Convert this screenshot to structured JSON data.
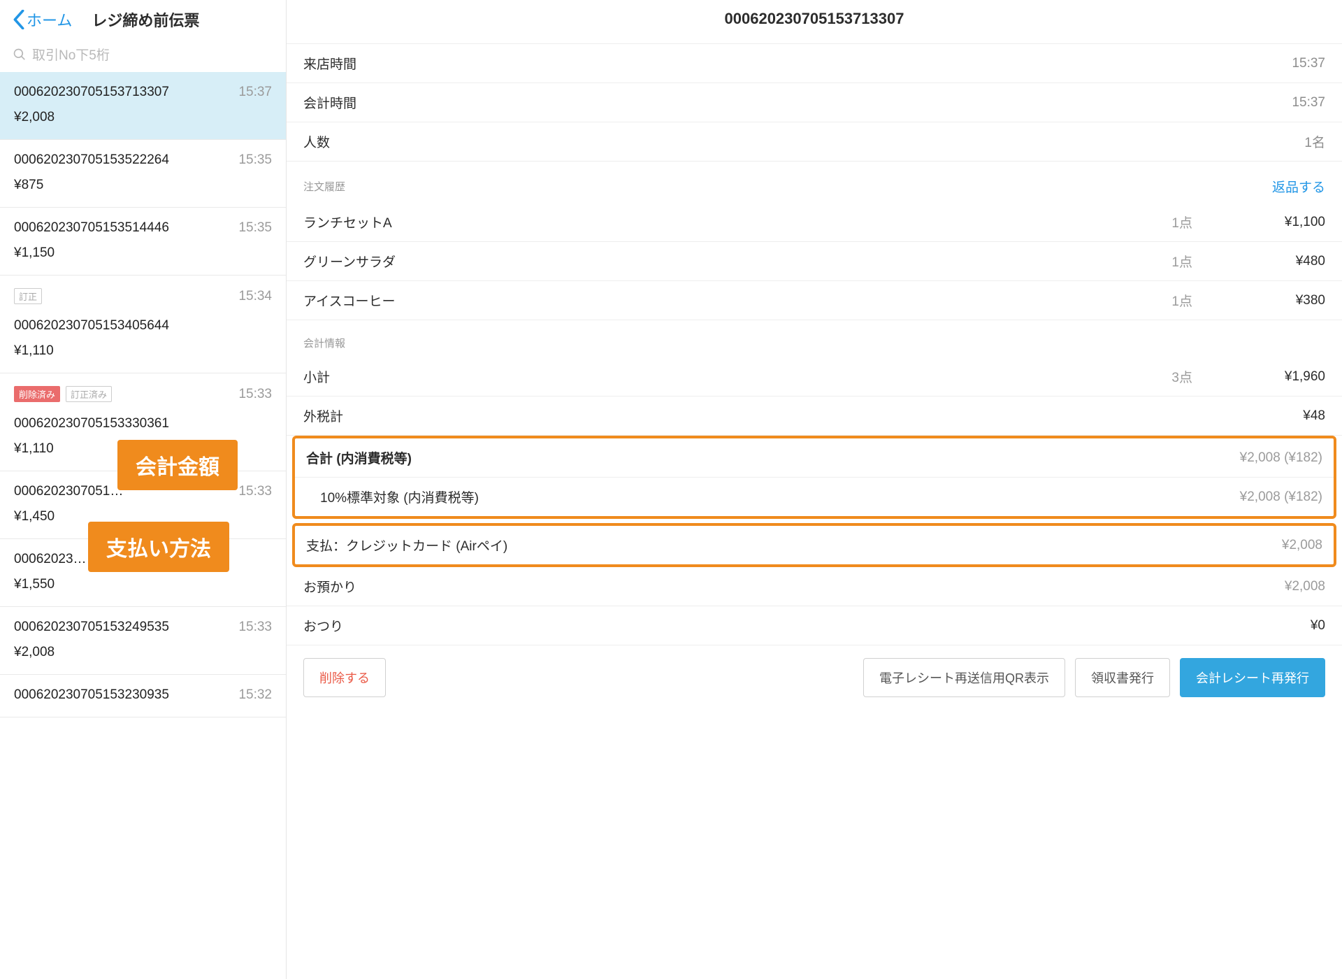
{
  "left": {
    "back_label": "ホーム",
    "title": "レジ締め前伝票",
    "search_placeholder": "取引No下5桁",
    "transactions": [
      {
        "no": "00062023070515371​3307",
        "time": "15:37",
        "amount": "¥2,008",
        "selected": true,
        "badges": []
      },
      {
        "no": "00062023070515352​2264",
        "time": "15:35",
        "amount": "¥875",
        "badges": []
      },
      {
        "no": "00062023070515351​4446",
        "time": "15:35",
        "amount": "¥1,150",
        "badges": []
      },
      {
        "no": "00062023070515340​5644",
        "time": "15:34",
        "amount": "¥1,110",
        "badges": [
          {
            "text": "訂正",
            "type": "gray"
          }
        ]
      },
      {
        "no": "00062023070515333​0361",
        "time": "15:33",
        "amount": "¥1,110",
        "badges": [
          {
            "text": "削除済み",
            "type": "red"
          },
          {
            "text": "訂正済み",
            "type": "gray"
          }
        ]
      },
      {
        "no": "000620230705​1…",
        "time": "15:33",
        "amount": "¥1,450",
        "badges": []
      },
      {
        "no": "0006202​3…",
        "time": "",
        "amount": "¥1,550",
        "badges": []
      },
      {
        "no": "00062023070515324​9535",
        "time": "15:33",
        "amount": "¥2,008",
        "badges": []
      },
      {
        "no": "00062023070515323​0935",
        "time": "15:32",
        "amount": "",
        "badges": []
      }
    ]
  },
  "right": {
    "title": "000620230705153713307",
    "visit_time_label": "来店時間",
    "visit_time": "15:37",
    "checkout_time_label": "会計時間",
    "checkout_time": "15:37",
    "guests_label": "人数",
    "guests": "1名",
    "order_history_label": "注文履歴",
    "return_link": "返品する",
    "orders": [
      {
        "name": "ランチセットA",
        "qty": "1点",
        "amount": "¥1,100"
      },
      {
        "name": "グリーンサラダ",
        "qty": "1点",
        "amount": "¥480"
      },
      {
        "name": "アイスコーヒー",
        "qty": "1点",
        "amount": "¥380"
      }
    ],
    "calc_label": "会計情報",
    "subtotal_label": "小計",
    "subtotal_qty": "3点",
    "subtotal_amt": "¥1,960",
    "tax_ext_label": "外税計",
    "tax_ext_amt": "¥48",
    "total_label": "合計 (内消費税等)",
    "total_amt": "¥2,008 (¥182)",
    "tax10_label": "10%標準対象 (内消費税等)",
    "tax10_amt": "¥2,008 (¥182)",
    "pay_label": "支払：クレジットカード (Airペイ)",
    "pay_amt": "¥2,008",
    "deposit_label": "お預かり",
    "deposit_amt": "¥2,008",
    "change_label": "おつり",
    "change_amt": "¥0",
    "buttons": {
      "delete": "削除する",
      "qr": "電子レシート再送信用QR表示",
      "receipt": "領収書発行",
      "reissue": "会計レシート再発行"
    }
  },
  "callouts": {
    "amount": "会計金額",
    "payment": "支払い方法"
  }
}
